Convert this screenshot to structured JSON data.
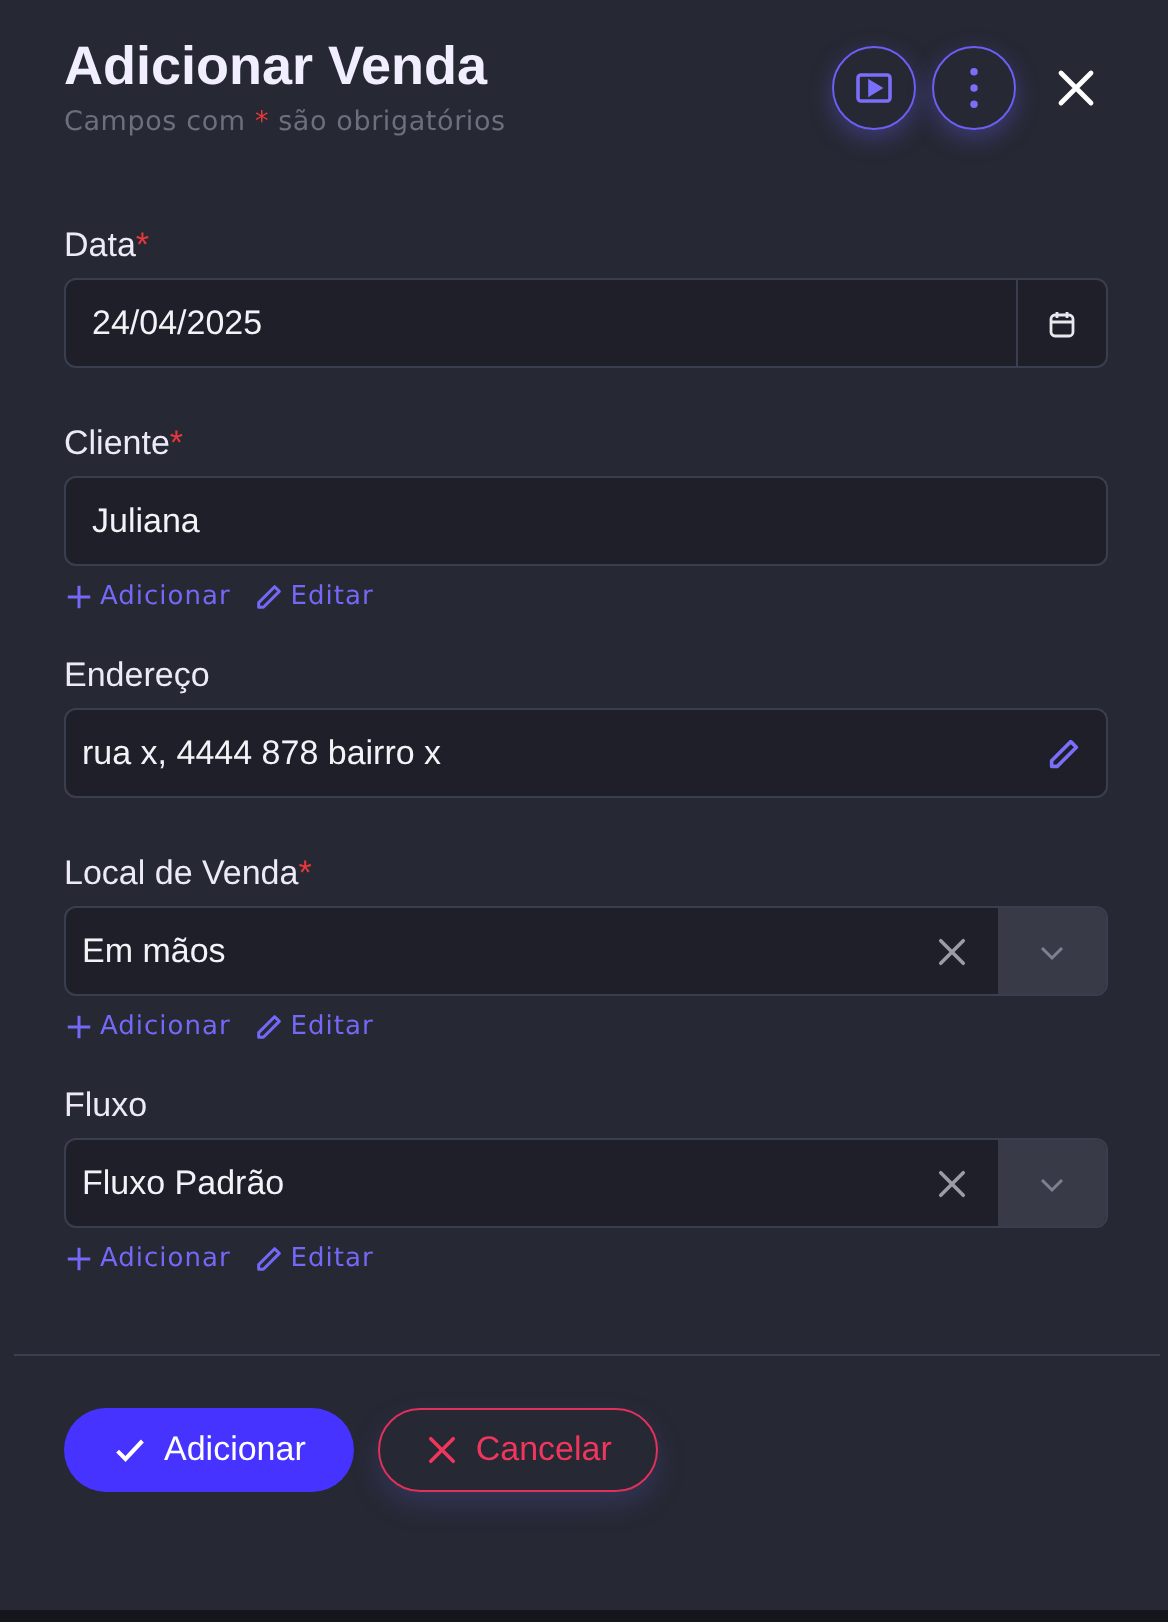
{
  "header": {
    "title": "Adicionar Venda",
    "subtitle": {
      "before": "Campos com ",
      "mark": "*",
      "after": " são obrigatórios"
    }
  },
  "fields": [
    {
      "kind": "date",
      "label": "Data",
      "required_mark": "*",
      "value": "24/04/2025"
    },
    {
      "kind": "text",
      "label": "Cliente",
      "required_mark": "*",
      "value": "Juliana",
      "actions": [
        {
          "kind": "add",
          "label": "Adicionar"
        },
        {
          "kind": "edit",
          "label": "Editar"
        }
      ]
    },
    {
      "kind": "editable",
      "label": "Endereço",
      "value": "rua x, 4444 878 bairro x"
    },
    {
      "kind": "select",
      "label": "Local de Venda",
      "required_mark": "*",
      "value": "Em mãos",
      "actions": [
        {
          "kind": "add",
          "label": "Adicionar"
        },
        {
          "kind": "edit",
          "label": "Editar"
        }
      ]
    },
    {
      "kind": "select",
      "label": "Fluxo",
      "value": "Fluxo Padrão",
      "actions": [
        {
          "kind": "add",
          "label": "Adicionar"
        },
        {
          "kind": "edit",
          "label": "Editar"
        }
      ]
    }
  ],
  "buttons": [
    {
      "kind": "primary",
      "label": "Adicionar"
    },
    {
      "kind": "danger",
      "label": "Cancelar"
    }
  ]
}
